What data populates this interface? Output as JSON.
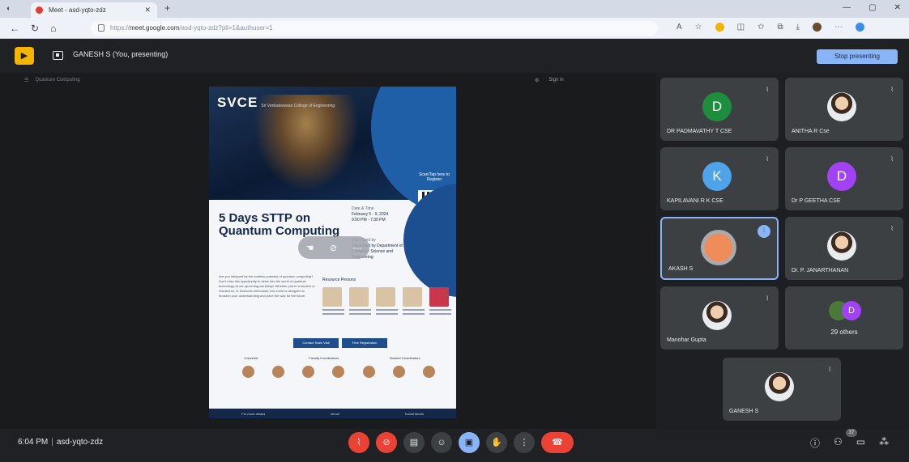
{
  "browser": {
    "tab_title": "Meet - asd-yqto-zdz",
    "new_tab": "+",
    "url_host": "meet.google.com",
    "url_path": "/asd-yqto-zdz?pli=1&authuser=1",
    "url_prefix": "https://"
  },
  "meet_header": {
    "presenting_label": "GANESH S (You, presenting)",
    "stop_presenting": "Stop presenting"
  },
  "shared_window": {
    "tab_label": "Quantum Computing",
    "sign_in": "Sign in"
  },
  "poster": {
    "logo": "SVCE",
    "logo_sub": "Sri Venkateswara College of Engineering",
    "scan_text": "Scan/Tap here to Register",
    "title": "5 Days STTP on Quantum Computing",
    "date_label": "Date & Time",
    "date_value": "February 5 - 9, 2024",
    "time_value": "9:00 PM - 7:30 PM",
    "organiser_label": "Organised by",
    "organiser": "Organised by Department of Computer Science and Engineering",
    "description": "Are you intrigued by the endless potential of quantum computing? Don't miss this opportunity to delve into the world of quantum technology at our upcoming workshop! Whether you're a student or researcher, or business enthusiast, this event is designed to broaden your understanding and pave the way for the future.",
    "resource_title": "Resource Persons",
    "btn_contact": "Contact Team Visit",
    "btn_register": "Free Registration",
    "convener": "Convener",
    "faculty_coord": "Faculty Coordinators",
    "student_coord": "Student Coordinators",
    "footer_left": "For more details",
    "footer_mid": "Venue",
    "footer_right": "Social Media"
  },
  "participants": [
    {
      "name": "DR PADMAVATHY T CSE",
      "initial": "D",
      "color": "#1e8e3e",
      "type": "letter"
    },
    {
      "name": "ANITHA R Cse",
      "initial": "",
      "color": "",
      "type": "photo"
    },
    {
      "name": "KAPILAVANI R K CSE",
      "initial": "K",
      "color": "#4fa3e8",
      "type": "letter"
    },
    {
      "name": "Dr P GEETHA CSE",
      "initial": "D",
      "color": "#a142f4",
      "type": "letter"
    },
    {
      "name": "AKASH S",
      "initial": "",
      "color": "",
      "type": "icon",
      "active": true
    },
    {
      "name": "Dr. P. JANARTHANAN",
      "initial": "",
      "color": "",
      "type": "photo"
    },
    {
      "name": "Manohar Gupta",
      "initial": "",
      "color": "",
      "type": "photo"
    }
  ],
  "others": {
    "initial": "D",
    "label": "29 others"
  },
  "self_tile": {
    "name": "GANESH S"
  },
  "bottom_bar": {
    "time": "6:04 PM",
    "separator": "|",
    "meeting_code": "asd-yqto-zdz",
    "participants_badge": "37"
  },
  "icons": {
    "mic_off": "mic-off-icon",
    "camera_off": "camera-off-icon",
    "captions": "captions-icon",
    "emoji": "emoji-icon",
    "present": "present-icon",
    "raise_hand": "raise-hand-icon",
    "more": "more-options-icon",
    "end_call": "end-call-icon",
    "info": "info-icon",
    "people": "people-icon",
    "chat": "chat-icon",
    "activities": "activities-icon"
  }
}
